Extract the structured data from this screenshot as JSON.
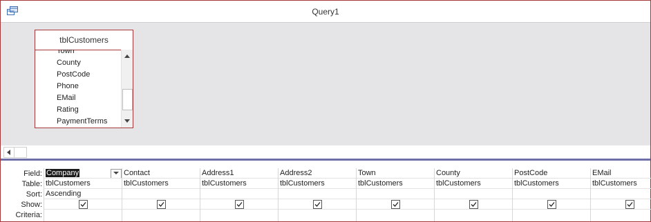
{
  "window": {
    "title": "Query1"
  },
  "table": {
    "name": "tblCustomers",
    "fields": [
      "Town",
      "County",
      "PostCode",
      "Phone",
      "EMail",
      "Rating",
      "PaymentTerms"
    ]
  },
  "grid": {
    "row_labels": {
      "field": "Field:",
      "table": "Table:",
      "sort": "Sort:",
      "show": "Show:",
      "criteria": "Criteria:"
    },
    "columns": [
      {
        "field": "Company",
        "table": "tblCustomers",
        "sort": "Ascending",
        "show": true
      },
      {
        "field": "Contact",
        "table": "tblCustomers",
        "sort": "",
        "show": true
      },
      {
        "field": "Address1",
        "table": "tblCustomers",
        "sort": "",
        "show": true
      },
      {
        "field": "Address2",
        "table": "tblCustomers",
        "sort": "",
        "show": true
      },
      {
        "field": "Town",
        "table": "tblCustomers",
        "sort": "",
        "show": true
      },
      {
        "field": "County",
        "table": "tblCustomers",
        "sort": "",
        "show": true
      },
      {
        "field": "PostCode",
        "table": "tblCustomers",
        "sort": "",
        "show": true
      },
      {
        "field": "EMail",
        "table": "tblCustomers",
        "sort": "",
        "show": true
      }
    ]
  },
  "colors": {
    "accent": "#a4373a",
    "design_bg": "#e5e5e8",
    "splitter": "#6f6fa8"
  }
}
